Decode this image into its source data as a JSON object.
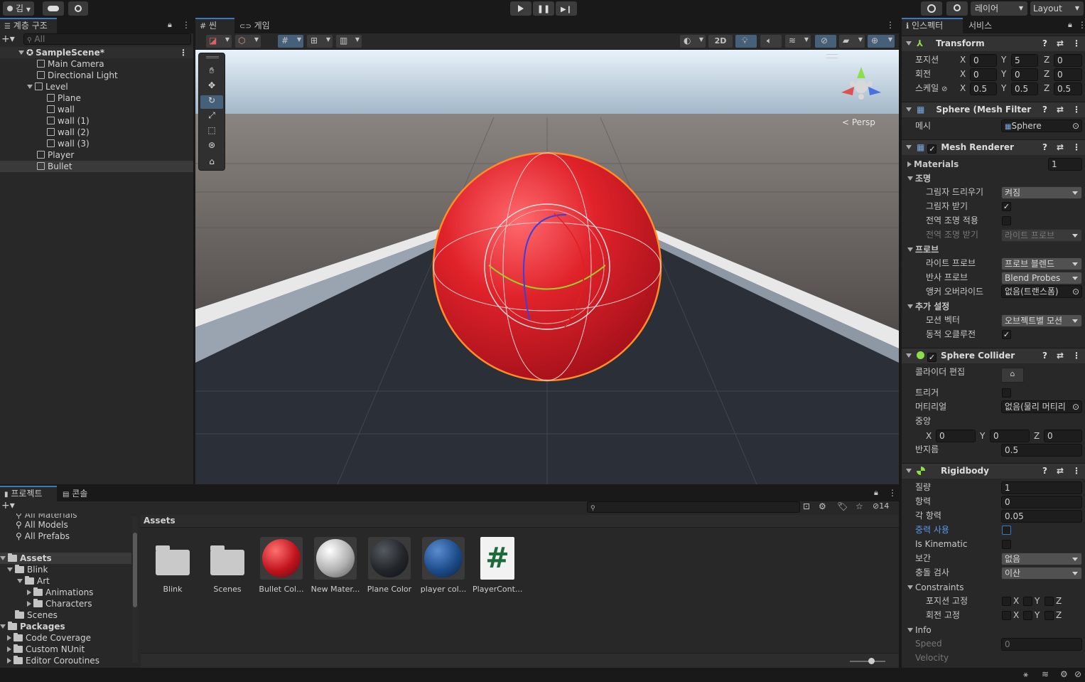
{
  "topbar": {
    "account": "김",
    "layers": "레이어",
    "layout": "Layout"
  },
  "hierarchy": {
    "tab": "계층 구조",
    "search_placeholder": "All",
    "scene": "SampleScene*",
    "items": [
      {
        "label": "Main Camera"
      },
      {
        "label": "Directional Light"
      },
      {
        "label": "Level"
      },
      {
        "label": "Plane"
      },
      {
        "label": "wall"
      },
      {
        "label": "wall (1)"
      },
      {
        "label": "wall (2)"
      },
      {
        "label": "wall (3)"
      },
      {
        "label": "Player"
      },
      {
        "label": "Bullet"
      }
    ]
  },
  "scene": {
    "tab_scene": "씬",
    "tab_game": "게임",
    "mode_2d": "2D",
    "persp": "Persp"
  },
  "project": {
    "tab_project": "프로젝트",
    "tab_console": "콘솔",
    "hidden_count": "14",
    "breadcrumb": "Assets",
    "favorites": [
      "All Materials",
      "All Models",
      "All Prefabs"
    ],
    "tree": [
      {
        "label": "Assets"
      },
      {
        "label": "Blink"
      },
      {
        "label": "Art"
      },
      {
        "label": "Animations"
      },
      {
        "label": "Characters"
      },
      {
        "label": "Scenes"
      },
      {
        "label": "Packages"
      },
      {
        "label": "Code Coverage"
      },
      {
        "label": "Custom NUnit"
      },
      {
        "label": "Editor Coroutines"
      }
    ],
    "assets": [
      {
        "label": "Blink"
      },
      {
        "label": "Scenes"
      },
      {
        "label": "Bullet Col..."
      },
      {
        "label": "New Mater..."
      },
      {
        "label": "Plane Color"
      },
      {
        "label": "player col..."
      },
      {
        "label": "PlayerCont..."
      }
    ]
  },
  "inspector": {
    "tab_inspector": "인스펙터",
    "tab_services": "서비스",
    "transform": {
      "title": "Transform",
      "position": "포지션",
      "rotation": "회전",
      "scale": "스케일",
      "pos": [
        "0",
        "5",
        "0"
      ],
      "rot": [
        "0",
        "0",
        "0"
      ],
      "scl": [
        "0.5",
        "0.5",
        "0.5"
      ]
    },
    "meshfilter": {
      "title": "Sphere (Mesh Filter",
      "mesh_label": "메시",
      "mesh": "Sphere"
    },
    "renderer": {
      "title": "Mesh Renderer",
      "materials": "Materials",
      "materials_count": "1",
      "lighting": "조명",
      "cast_shadows": "그림자 드리우기",
      "cast_shadows_value": "켜짐",
      "receive_shadows": "그림자 받기",
      "contribute_gi": "전역 조명 적용",
      "receive_gi": "전역 조명 받기",
      "receive_gi_value": "라이트 프로브",
      "probes": "프로브",
      "light_probes": "라이트 프로브",
      "light_probes_value": "프로브 블렌드",
      "reflection_probes": "반사 프로브",
      "reflection_probes_value": "Blend Probes",
      "anchor_override": "앵커 오버라이드",
      "anchor_override_value": "없음(트랜스폼)",
      "additional": "추가 설정",
      "motion_vectors": "모션 벡터",
      "motion_vectors_value": "오브젝트별 모션",
      "dynamic_occlusion": "동적 오클루전"
    },
    "collider": {
      "title": "Sphere Collider",
      "edit_collider": "콜라이더 편집",
      "trigger": "트리거",
      "material": "머티리얼",
      "material_value": "없음(물리 머티리",
      "center": "중앙",
      "center_vals": [
        "0",
        "0",
        "0"
      ],
      "radius": "반지름",
      "radius_value": "0.5"
    },
    "rigidbody": {
      "title": "Rigidbody",
      "mass": "질량",
      "mass_value": "1",
      "drag": "항력",
      "drag_value": "0",
      "angular_drag": "각 항력",
      "angular_drag_value": "0.05",
      "use_gravity": "중력 사용",
      "is_kinematic": "Is Kinematic",
      "interpolate": "보간",
      "interpolate_value": "없음",
      "collision": "충돌 검사",
      "collision_value": "이산",
      "constraints": "Constraints",
      "freeze_position": "포지션 고정",
      "freeze_rotation": "회전 고정",
      "info": "Info",
      "speed": "Speed",
      "speed_value": "0",
      "velocity": "Velocity"
    }
  },
  "axis": {
    "x": "X",
    "y": "Y",
    "z": "Z"
  }
}
